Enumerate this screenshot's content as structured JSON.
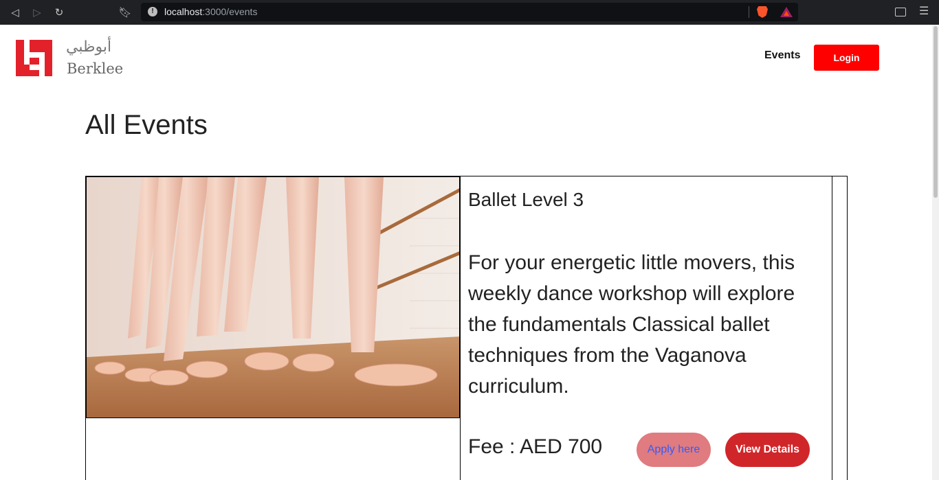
{
  "browser": {
    "url_host": "localhost",
    "url_path": ":3000/events"
  },
  "header": {
    "logo_arabic": "أبوظبي",
    "logo_name": "Berklee",
    "nav_events": "Events",
    "login_label": "Login"
  },
  "main": {
    "title": "All Events",
    "events": [
      {
        "name": "Ballet Level 3",
        "description": "For your energetic little movers, this weekly dance workshop will explore the fundamentals Classical ballet techniques from the Vaganova curriculum.",
        "fee": "Fee : AED 700",
        "apply_label": "Apply here",
        "details_label": "View Details"
      }
    ]
  },
  "colors": {
    "brand_red": "#e3212b",
    "login_red": "#ff0000",
    "apply_pink": "#e07b80",
    "details_red": "#d0262a"
  }
}
